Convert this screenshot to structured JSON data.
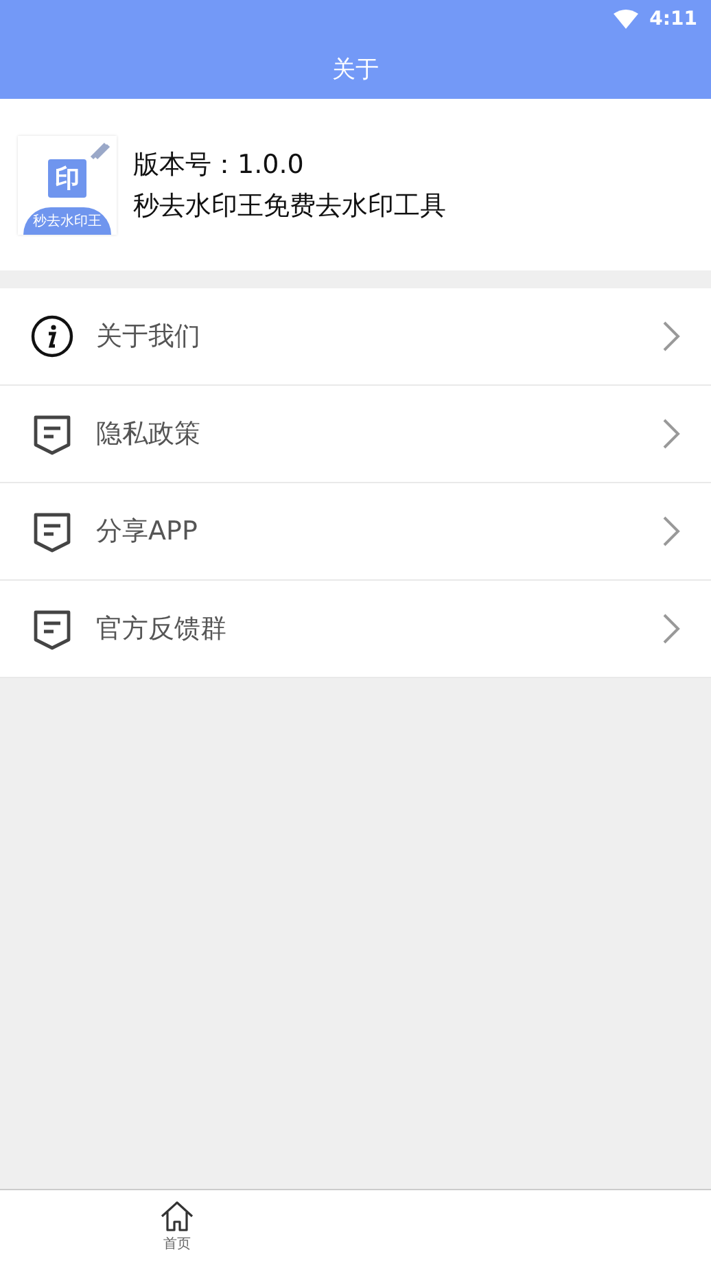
{
  "status_bar": {
    "time": "4:11"
  },
  "title": "关于",
  "app_info": {
    "logo": {
      "glyph": "印",
      "caption": "秒去水印王"
    },
    "version": "版本号：1.0.0",
    "name": "秒去水印王免费去水印工具"
  },
  "menu": [
    {
      "kind": "info",
      "label": "关于我们"
    },
    {
      "kind": "note",
      "label": "隐私政策"
    },
    {
      "kind": "note",
      "label": "分享APP"
    },
    {
      "kind": "note",
      "label": "官方反馈群"
    }
  ],
  "bottom_nav": [
    {
      "kind": "home",
      "label": "首页"
    }
  ]
}
